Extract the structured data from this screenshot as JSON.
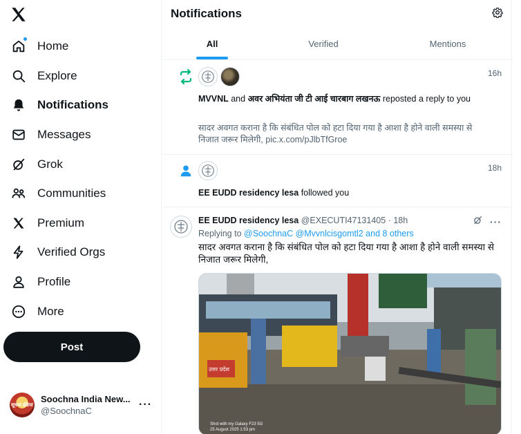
{
  "sidebar": {
    "logo": "x-logo",
    "nav": [
      {
        "label": "Home",
        "icon": "home-icon"
      },
      {
        "label": "Explore",
        "icon": "search-icon"
      },
      {
        "label": "Notifications",
        "icon": "bell-icon"
      },
      {
        "label": "Messages",
        "icon": "envelope-icon"
      },
      {
        "label": "Grok",
        "icon": "grok-icon"
      },
      {
        "label": "Communities",
        "icon": "people-icon"
      },
      {
        "label": "Premium",
        "icon": "x-logo-icon"
      },
      {
        "label": "Verified Orgs",
        "icon": "lightning-icon"
      },
      {
        "label": "Profile",
        "icon": "person-icon"
      },
      {
        "label": "More",
        "icon": "more-circle-icon"
      }
    ],
    "post_label": "Post",
    "account": {
      "name": "Soochna India New...",
      "handle": "@SoochnaC",
      "avatar_text": "सूचना इंडिया",
      "more": "···"
    }
  },
  "main": {
    "title": "Notifications",
    "tabs": [
      {
        "label": "All",
        "active": true
      },
      {
        "label": "Verified",
        "active": false
      },
      {
        "label": "Mentions",
        "active": false
      }
    ],
    "notifications": [
      {
        "type": "repost",
        "time": "16h",
        "actor1": "MVVNL",
        "connector": "and",
        "actor2": "अवर अभियंता जी टी आई चारबाग लखनऊ",
        "action": "reposted a reply to you",
        "excerpt": "सादर अवगत कराना है कि संबंधित पोल को हटा दिया गया है आशा है होने वाली समस्या से निजात जरूर मिलेगी, pic.x.com/pJlbTfGroe"
      },
      {
        "type": "follow",
        "time": "18h",
        "actor": "EE EUDD residency lesa",
        "action": "followed you"
      }
    ],
    "tweet": {
      "name": "EE EUDD residency lesa",
      "handle": "@EXECUTI47131405",
      "separator": "·",
      "time": "18h",
      "replying_prefix": "Replying to",
      "replying_to": "@SoochnaC @Mvvnlcisgomtl2 and 8 others",
      "text": "सादर अवगत कराना है कि संबंधित पोल को हटा दिया गया है आशा है होने वाली समस्या से निजात जरूर मिलेगी,",
      "more": "···",
      "media_caption_1": "Shot with my Galaxy F23 5G",
      "media_caption_2": "25 August 2025 1:53 pm",
      "media_sign": "उत्तर प्रदेश"
    }
  },
  "colors": {
    "accent": "#1d9bf0",
    "repost_green": "#00ba7c",
    "text": "#0f1419",
    "muted": "#536471"
  }
}
